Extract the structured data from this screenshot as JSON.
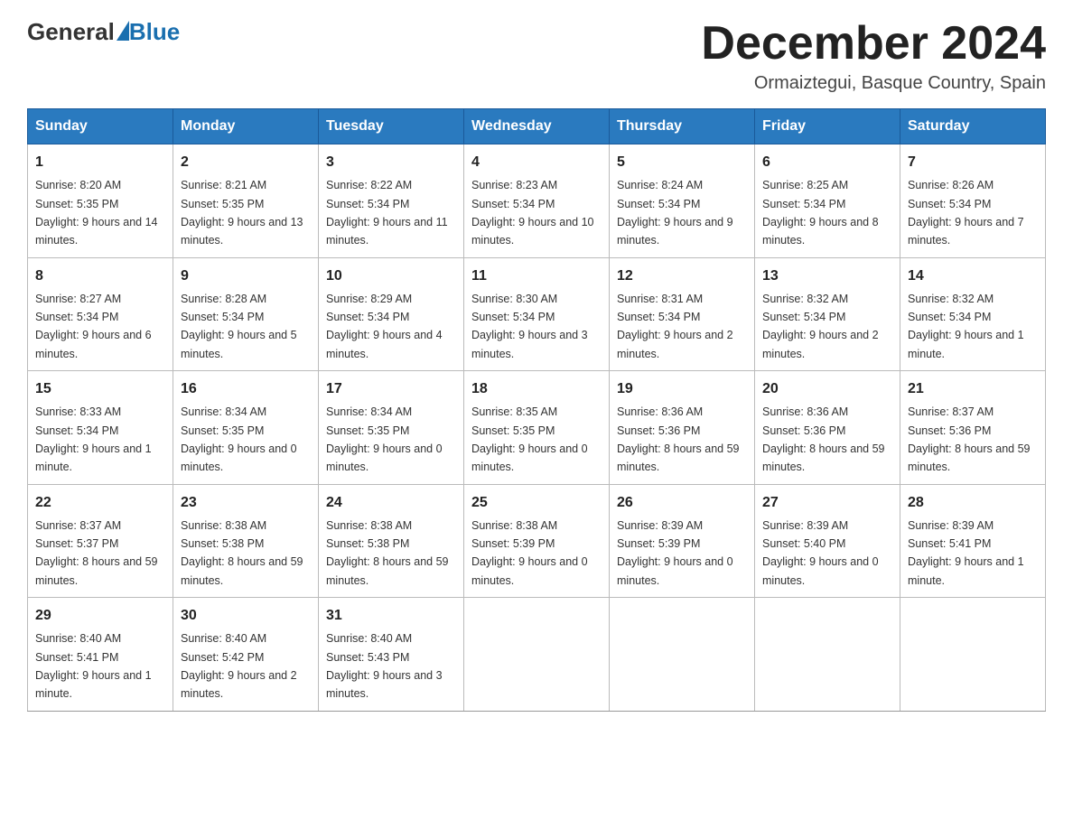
{
  "header": {
    "logo_general": "General",
    "logo_blue": "Blue",
    "month_title": "December 2024",
    "location": "Ormaiztegui, Basque Country, Spain"
  },
  "weekdays": [
    "Sunday",
    "Monday",
    "Tuesday",
    "Wednesday",
    "Thursday",
    "Friday",
    "Saturday"
  ],
  "weeks": [
    [
      {
        "day": "1",
        "sunrise": "8:20 AM",
        "sunset": "5:35 PM",
        "daylight": "9 hours and 14 minutes."
      },
      {
        "day": "2",
        "sunrise": "8:21 AM",
        "sunset": "5:35 PM",
        "daylight": "9 hours and 13 minutes."
      },
      {
        "day": "3",
        "sunrise": "8:22 AM",
        "sunset": "5:34 PM",
        "daylight": "9 hours and 11 minutes."
      },
      {
        "day": "4",
        "sunrise": "8:23 AM",
        "sunset": "5:34 PM",
        "daylight": "9 hours and 10 minutes."
      },
      {
        "day": "5",
        "sunrise": "8:24 AM",
        "sunset": "5:34 PM",
        "daylight": "9 hours and 9 minutes."
      },
      {
        "day": "6",
        "sunrise": "8:25 AM",
        "sunset": "5:34 PM",
        "daylight": "9 hours and 8 minutes."
      },
      {
        "day": "7",
        "sunrise": "8:26 AM",
        "sunset": "5:34 PM",
        "daylight": "9 hours and 7 minutes."
      }
    ],
    [
      {
        "day": "8",
        "sunrise": "8:27 AM",
        "sunset": "5:34 PM",
        "daylight": "9 hours and 6 minutes."
      },
      {
        "day": "9",
        "sunrise": "8:28 AM",
        "sunset": "5:34 PM",
        "daylight": "9 hours and 5 minutes."
      },
      {
        "day": "10",
        "sunrise": "8:29 AM",
        "sunset": "5:34 PM",
        "daylight": "9 hours and 4 minutes."
      },
      {
        "day": "11",
        "sunrise": "8:30 AM",
        "sunset": "5:34 PM",
        "daylight": "9 hours and 3 minutes."
      },
      {
        "day": "12",
        "sunrise": "8:31 AM",
        "sunset": "5:34 PM",
        "daylight": "9 hours and 2 minutes."
      },
      {
        "day": "13",
        "sunrise": "8:32 AM",
        "sunset": "5:34 PM",
        "daylight": "9 hours and 2 minutes."
      },
      {
        "day": "14",
        "sunrise": "8:32 AM",
        "sunset": "5:34 PM",
        "daylight": "9 hours and 1 minute."
      }
    ],
    [
      {
        "day": "15",
        "sunrise": "8:33 AM",
        "sunset": "5:34 PM",
        "daylight": "9 hours and 1 minute."
      },
      {
        "day": "16",
        "sunrise": "8:34 AM",
        "sunset": "5:35 PM",
        "daylight": "9 hours and 0 minutes."
      },
      {
        "day": "17",
        "sunrise": "8:34 AM",
        "sunset": "5:35 PM",
        "daylight": "9 hours and 0 minutes."
      },
      {
        "day": "18",
        "sunrise": "8:35 AM",
        "sunset": "5:35 PM",
        "daylight": "9 hours and 0 minutes."
      },
      {
        "day": "19",
        "sunrise": "8:36 AM",
        "sunset": "5:36 PM",
        "daylight": "8 hours and 59 minutes."
      },
      {
        "day": "20",
        "sunrise": "8:36 AM",
        "sunset": "5:36 PM",
        "daylight": "8 hours and 59 minutes."
      },
      {
        "day": "21",
        "sunrise": "8:37 AM",
        "sunset": "5:36 PM",
        "daylight": "8 hours and 59 minutes."
      }
    ],
    [
      {
        "day": "22",
        "sunrise": "8:37 AM",
        "sunset": "5:37 PM",
        "daylight": "8 hours and 59 minutes."
      },
      {
        "day": "23",
        "sunrise": "8:38 AM",
        "sunset": "5:38 PM",
        "daylight": "8 hours and 59 minutes."
      },
      {
        "day": "24",
        "sunrise": "8:38 AM",
        "sunset": "5:38 PM",
        "daylight": "8 hours and 59 minutes."
      },
      {
        "day": "25",
        "sunrise": "8:38 AM",
        "sunset": "5:39 PM",
        "daylight": "9 hours and 0 minutes."
      },
      {
        "day": "26",
        "sunrise": "8:39 AM",
        "sunset": "5:39 PM",
        "daylight": "9 hours and 0 minutes."
      },
      {
        "day": "27",
        "sunrise": "8:39 AM",
        "sunset": "5:40 PM",
        "daylight": "9 hours and 0 minutes."
      },
      {
        "day": "28",
        "sunrise": "8:39 AM",
        "sunset": "5:41 PM",
        "daylight": "9 hours and 1 minute."
      }
    ],
    [
      {
        "day": "29",
        "sunrise": "8:40 AM",
        "sunset": "5:41 PM",
        "daylight": "9 hours and 1 minute."
      },
      {
        "day": "30",
        "sunrise": "8:40 AM",
        "sunset": "5:42 PM",
        "daylight": "9 hours and 2 minutes."
      },
      {
        "day": "31",
        "sunrise": "8:40 AM",
        "sunset": "5:43 PM",
        "daylight": "9 hours and 3 minutes."
      },
      null,
      null,
      null,
      null
    ]
  ],
  "labels": {
    "sunrise": "Sunrise:",
    "sunset": "Sunset:",
    "daylight": "Daylight:"
  }
}
